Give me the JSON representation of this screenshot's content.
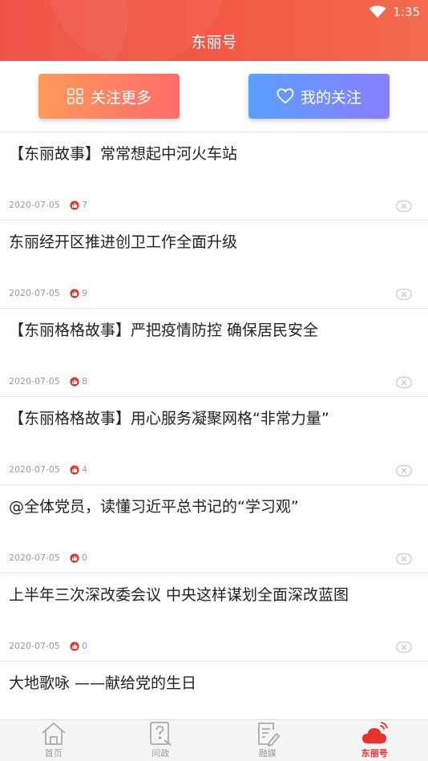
{
  "status": {
    "time": "1:35"
  },
  "header": {
    "title": "东丽号"
  },
  "actions": {
    "follow_more": "关注更多",
    "my_follow": "我的关注"
  },
  "articles": [
    {
      "title": "【东丽故事】常常想起中河火车站",
      "date": "2020-07-05",
      "likes": "7"
    },
    {
      "title": "东丽经开区推进创卫工作全面升级",
      "date": "2020-07-05",
      "likes": "9"
    },
    {
      "title": "【东丽格格故事】严把疫情防控 确保居民安全",
      "date": "2020-07-05",
      "likes": "8"
    },
    {
      "title": "【东丽格格故事】用心服务凝聚网格“非常力量”",
      "date": "2020-07-05",
      "likes": "4"
    },
    {
      "title": "@全体党员，读懂习近平总书记的“学习观”",
      "date": "2020-07-05",
      "likes": "0"
    },
    {
      "title": "上半年三次深改委会议 中央这样谋划全面深改蓝图",
      "date": "2020-07-05",
      "likes": "0"
    },
    {
      "title": "大地歌咏 ——献给党的生日",
      "date": "",
      "likes": ""
    }
  ],
  "nav": [
    {
      "label": "首页",
      "icon": "home-icon"
    },
    {
      "label": "问政",
      "icon": "question-doc-icon"
    },
    {
      "label": "融媒",
      "icon": "edit-doc-icon"
    },
    {
      "label": "东丽号",
      "icon": "cloud-signal-icon",
      "active": true
    }
  ],
  "colors": {
    "brand": "#ef4a3c",
    "like": "#e8322a",
    "active_nav": "#e8322a"
  }
}
